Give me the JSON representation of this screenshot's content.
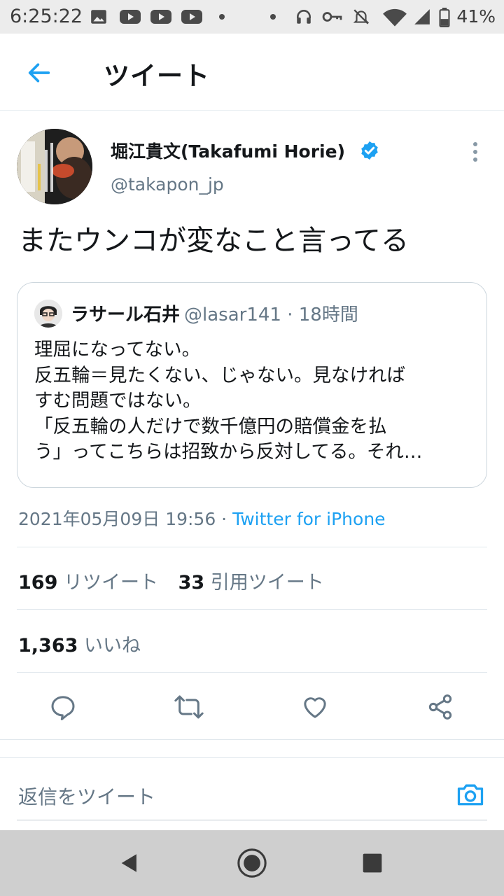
{
  "status_bar": {
    "time": "6:25:22",
    "battery": "41%",
    "icons": [
      "image-icon",
      "youtube-icon",
      "youtube-icon",
      "youtube-icon",
      "dot-icon",
      "dot-icon",
      "headphones-icon",
      "key-icon",
      "mute-icon",
      "wifi-icon",
      "signal-icon",
      "battery-icon"
    ]
  },
  "header": {
    "title": "ツイート"
  },
  "tweet": {
    "author_name": "堀江貴文(Takafumi Horie)",
    "author_handle": "@takapon_jp",
    "text": "またウンコが変なこと言ってる",
    "timestamp": "2021年05月09日 19:56 · ",
    "source": "Twitter for iPhone",
    "retweets": "169",
    "retweets_label": "リツイート",
    "quotes": "33",
    "quotes_label": "引用ツイート",
    "likes": "1,363",
    "likes_label": "いいね"
  },
  "quote": {
    "name": "ラサール石井",
    "handle": "@lasar141 · 18時間",
    "lines": [
      "理屈になってない。",
      "反五輪＝見たくない、じゃない。見なければ",
      "すむ問題ではない。",
      "「反五輪の人だけで数千億円の賠償金を払",
      "う」ってこちらは招致から反対してる。それ…"
    ]
  },
  "reply": {
    "placeholder": "返信をツイート"
  },
  "colors": {
    "accent": "#1da1f2",
    "secondary_text": "#657786",
    "border": "#e1e8ed"
  }
}
